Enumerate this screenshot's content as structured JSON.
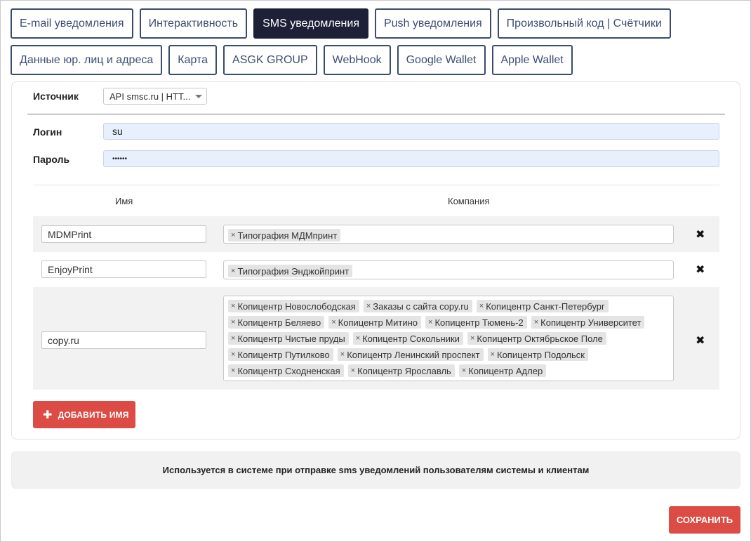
{
  "tabs_row1": [
    {
      "label": "E-mail уведомления",
      "active": false
    },
    {
      "label": "Интерактивность",
      "active": false
    },
    {
      "label": "SMS уведомления",
      "active": true
    },
    {
      "label": "Push уведомления",
      "active": false
    },
    {
      "label": "Произвольный код | Счётчики",
      "active": false
    }
  ],
  "tabs_row2": [
    {
      "label": "Данные юр. лиц и адреса",
      "active": false
    },
    {
      "label": "Карта",
      "active": false
    },
    {
      "label": "ASGK GROUP",
      "active": false
    },
    {
      "label": "WebHook",
      "active": false
    },
    {
      "label": "Google Wallet",
      "active": false
    },
    {
      "label": "Apple Wallet",
      "active": false
    }
  ],
  "form": {
    "source_label": "Источник",
    "source_value": "API smsc.ru | HTT...",
    "login_label": "Логин",
    "login_value": "su",
    "password_label": "Пароль",
    "password_value": "••••••"
  },
  "table": {
    "col_name": "Имя",
    "col_company": "Компания",
    "rows": [
      {
        "name": "MDMPrint",
        "companies": [
          "Типография МДМпринт"
        ]
      },
      {
        "name": "EnjoyPrint",
        "companies": [
          "Типография Энджойпринт"
        ]
      },
      {
        "name": "copy.ru",
        "companies": [
          "Копицентр Новослободская",
          "Заказы с сайта copy.ru",
          "Копицентр Санкт-Петербург",
          "Копицентр Беляево",
          "Копицентр Митино",
          "Копицентр Тюмень-2",
          "Копицентр Университет",
          "Копицентр Чистые пруды",
          "Копицентр Сокольники",
          "Копицентр Октябрьское Поле",
          "Копицентр Путилково",
          "Копицентр Ленинский проспект",
          "Копицентр Подольск",
          "Копицентр Сходненская",
          "Копицентр Ярославль",
          "Копицентр Адлер"
        ]
      }
    ],
    "delete_glyph": "✖",
    "tag_remove_glyph": "×"
  },
  "add_button": {
    "icon": "plus-icon",
    "glyph": "✚",
    "label": "ДОБАВИТЬ ИМЯ"
  },
  "info_text": "Используется в системе при отправке sms уведомлений пользователям системы и клиентам",
  "save_button": {
    "label": "СОХРАНИТЬ"
  },
  "colors": {
    "accent_red": "#dd4b45",
    "active_tab": "#1e2038",
    "tab_border": "#3b4b6b",
    "input_bg": "#e8f0fe"
  }
}
